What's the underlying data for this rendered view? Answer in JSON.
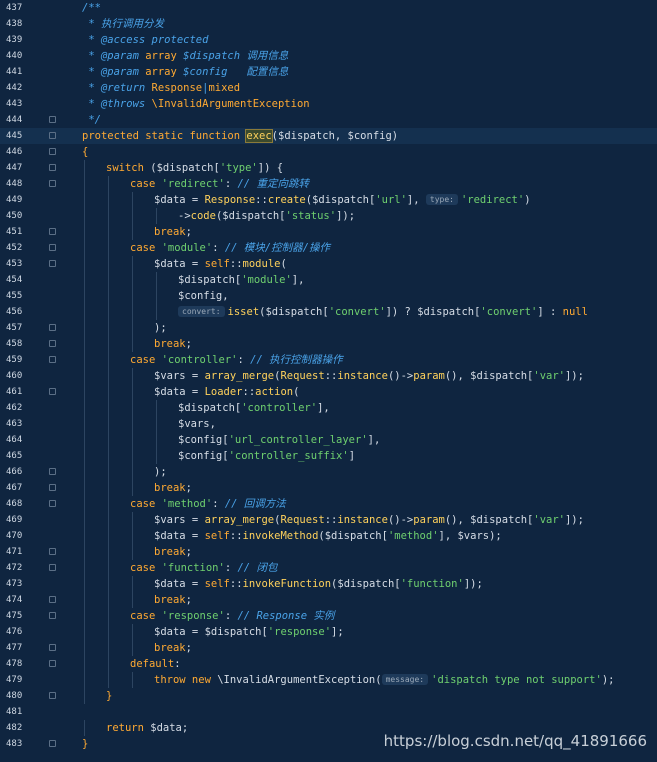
{
  "editor": {
    "lines": [
      {
        "n": "437",
        "indent": 0,
        "fold": false,
        "tokens": [
          {
            "t": "/**",
            "c": "cm"
          }
        ]
      },
      {
        "n": "438",
        "indent": 0,
        "fold": false,
        "tokens": [
          {
            "t": " * 执行调用分发",
            "c": "cm"
          }
        ]
      },
      {
        "n": "439",
        "indent": 0,
        "fold": false,
        "tokens": [
          {
            "t": " * @access protected",
            "c": "cm"
          }
        ]
      },
      {
        "n": "440",
        "indent": 0,
        "fold": false,
        "tokens": [
          {
            "t": " * @param ",
            "c": "cm"
          },
          {
            "t": "array",
            "c": "kw"
          },
          {
            "t": " $dispatch ",
            "c": "cm"
          },
          {
            "t": "调用信息",
            "c": "cm"
          }
        ]
      },
      {
        "n": "441",
        "indent": 0,
        "fold": false,
        "tokens": [
          {
            "t": " * @param ",
            "c": "cm"
          },
          {
            "t": "array",
            "c": "kw"
          },
          {
            "t": " $config   ",
            "c": "cm"
          },
          {
            "t": "配置信息",
            "c": "cm"
          }
        ]
      },
      {
        "n": "442",
        "indent": 0,
        "fold": false,
        "tokens": [
          {
            "t": " * @return ",
            "c": "cm"
          },
          {
            "t": "Response",
            "c": "kw"
          },
          {
            "t": "|",
            "c": "cm"
          },
          {
            "t": "mixed",
            "c": "kw"
          }
        ]
      },
      {
        "n": "443",
        "indent": 0,
        "fold": false,
        "tokens": [
          {
            "t": " * @throws ",
            "c": "cm"
          },
          {
            "t": "\\InvalidArgumentException",
            "c": "kw"
          }
        ]
      },
      {
        "n": "444",
        "indent": 0,
        "fold": true,
        "tokens": [
          {
            "t": " */",
            "c": "cm"
          }
        ]
      },
      {
        "n": "445",
        "indent": 0,
        "fold": true,
        "current": true,
        "tokens": [
          {
            "t": "protected static function ",
            "c": "kw"
          },
          {
            "t": "exec",
            "c": "fn",
            "hl": true
          },
          {
            "t": "($dispatch, $config)",
            "c": "var"
          }
        ]
      },
      {
        "n": "446",
        "indent": 0,
        "fold": true,
        "tokens": [
          {
            "t": "{",
            "c": "kw"
          }
        ]
      },
      {
        "n": "447",
        "indent": 1,
        "fold": true,
        "tokens": [
          {
            "t": "switch ",
            "c": "kw"
          },
          {
            "t": "($dispatch[",
            "c": "var"
          },
          {
            "t": "'type'",
            "c": "str"
          },
          {
            "t": "]) {",
            "c": "var"
          }
        ]
      },
      {
        "n": "448",
        "indent": 2,
        "fold": true,
        "tokens": [
          {
            "t": "case ",
            "c": "kw"
          },
          {
            "t": "'redirect'",
            "c": "str"
          },
          {
            "t": ": ",
            "c": "var"
          },
          {
            "t": "// 重定向跳转",
            "c": "cm"
          }
        ]
      },
      {
        "n": "449",
        "indent": 3,
        "fold": false,
        "tokens": [
          {
            "t": "$data = ",
            "c": "var"
          },
          {
            "t": "Response",
            "c": "cls"
          },
          {
            "t": "::",
            "c": "var"
          },
          {
            "t": "create",
            "c": "fn"
          },
          {
            "t": "($dispatch[",
            "c": "var"
          },
          {
            "t": "'url'",
            "c": "str"
          },
          {
            "t": "], ",
            "c": "var"
          },
          {
            "hint": "type:"
          },
          {
            "t": "'redirect'",
            "c": "str"
          },
          {
            "t": ")",
            "c": "var"
          }
        ]
      },
      {
        "n": "450",
        "indent": 4,
        "fold": false,
        "tokens": [
          {
            "t": "->",
            "c": "var"
          },
          {
            "t": "code",
            "c": "fn"
          },
          {
            "t": "($dispatch[",
            "c": "var"
          },
          {
            "t": "'status'",
            "c": "str"
          },
          {
            "t": "]);",
            "c": "var"
          }
        ]
      },
      {
        "n": "451",
        "indent": 3,
        "fold": true,
        "tokens": [
          {
            "t": "break",
            "c": "kw"
          },
          {
            "t": ";",
            "c": "var"
          }
        ]
      },
      {
        "n": "452",
        "indent": 2,
        "fold": true,
        "tokens": [
          {
            "t": "case ",
            "c": "kw"
          },
          {
            "t": "'module'",
            "c": "str"
          },
          {
            "t": ": ",
            "c": "var"
          },
          {
            "t": "// 模块/控制器/操作",
            "c": "cm"
          }
        ]
      },
      {
        "n": "453",
        "indent": 3,
        "fold": true,
        "tokens": [
          {
            "t": "$data = ",
            "c": "var"
          },
          {
            "t": "self",
            "c": "kw"
          },
          {
            "t": "::",
            "c": "var"
          },
          {
            "t": "module",
            "c": "fn"
          },
          {
            "t": "(",
            "c": "var"
          }
        ]
      },
      {
        "n": "454",
        "indent": 4,
        "fold": false,
        "tokens": [
          {
            "t": "$dispatch[",
            "c": "var"
          },
          {
            "t": "'module'",
            "c": "str"
          },
          {
            "t": "],",
            "c": "var"
          }
        ]
      },
      {
        "n": "455",
        "indent": 4,
        "fold": false,
        "tokens": [
          {
            "t": "$config,",
            "c": "var"
          }
        ]
      },
      {
        "n": "456",
        "indent": 4,
        "fold": false,
        "tokens": [
          {
            "hint": "convert:"
          },
          {
            "t": "isset",
            "c": "fn"
          },
          {
            "t": "($dispatch[",
            "c": "var"
          },
          {
            "t": "'convert'",
            "c": "str"
          },
          {
            "t": "]) ? $dispatch[",
            "c": "var"
          },
          {
            "t": "'convert'",
            "c": "str"
          },
          {
            "t": "] : ",
            "c": "var"
          },
          {
            "t": "null",
            "c": "kw"
          }
        ]
      },
      {
        "n": "457",
        "indent": 3,
        "fold": true,
        "tokens": [
          {
            "t": ");",
            "c": "var"
          }
        ]
      },
      {
        "n": "458",
        "indent": 3,
        "fold": true,
        "tokens": [
          {
            "t": "break",
            "c": "kw"
          },
          {
            "t": ";",
            "c": "var"
          }
        ]
      },
      {
        "n": "459",
        "indent": 2,
        "fold": true,
        "tokens": [
          {
            "t": "case ",
            "c": "kw"
          },
          {
            "t": "'controller'",
            "c": "str"
          },
          {
            "t": ": ",
            "c": "var"
          },
          {
            "t": "// 执行控制器操作",
            "c": "cm"
          }
        ]
      },
      {
        "n": "460",
        "indent": 3,
        "fold": false,
        "tokens": [
          {
            "t": "$vars = ",
            "c": "var"
          },
          {
            "t": "array_merge",
            "c": "fn"
          },
          {
            "t": "(",
            "c": "var"
          },
          {
            "t": "Request",
            "c": "cls"
          },
          {
            "t": "::",
            "c": "var"
          },
          {
            "t": "instance",
            "c": "fn"
          },
          {
            "t": "()->",
            "c": "var"
          },
          {
            "t": "param",
            "c": "fn"
          },
          {
            "t": "(), $dispatch[",
            "c": "var"
          },
          {
            "t": "'var'",
            "c": "str"
          },
          {
            "t": "]);",
            "c": "var"
          }
        ]
      },
      {
        "n": "461",
        "indent": 3,
        "fold": true,
        "tokens": [
          {
            "t": "$data = ",
            "c": "var"
          },
          {
            "t": "Loader",
            "c": "cls"
          },
          {
            "t": "::",
            "c": "var"
          },
          {
            "t": "action",
            "c": "fn"
          },
          {
            "t": "(",
            "c": "var"
          }
        ]
      },
      {
        "n": "462",
        "indent": 4,
        "fold": false,
        "tokens": [
          {
            "t": "$dispatch[",
            "c": "var"
          },
          {
            "t": "'controller'",
            "c": "str"
          },
          {
            "t": "],",
            "c": "var"
          }
        ]
      },
      {
        "n": "463",
        "indent": 4,
        "fold": false,
        "tokens": [
          {
            "t": "$vars,",
            "c": "var"
          }
        ]
      },
      {
        "n": "464",
        "indent": 4,
        "fold": false,
        "tokens": [
          {
            "t": "$config[",
            "c": "var"
          },
          {
            "t": "'url_controller_layer'",
            "c": "str"
          },
          {
            "t": "],",
            "c": "var"
          }
        ]
      },
      {
        "n": "465",
        "indent": 4,
        "fold": false,
        "tokens": [
          {
            "t": "$config[",
            "c": "var"
          },
          {
            "t": "'controller_suffix'",
            "c": "str"
          },
          {
            "t": "]",
            "c": "var"
          }
        ]
      },
      {
        "n": "466",
        "indent": 3,
        "fold": true,
        "tokens": [
          {
            "t": ");",
            "c": "var"
          }
        ]
      },
      {
        "n": "467",
        "indent": 3,
        "fold": true,
        "tokens": [
          {
            "t": "break",
            "c": "kw"
          },
          {
            "t": ";",
            "c": "var"
          }
        ]
      },
      {
        "n": "468",
        "indent": 2,
        "fold": true,
        "tokens": [
          {
            "t": "case ",
            "c": "kw"
          },
          {
            "t": "'method'",
            "c": "str"
          },
          {
            "t": ": ",
            "c": "var"
          },
          {
            "t": "// 回调方法",
            "c": "cm"
          }
        ]
      },
      {
        "n": "469",
        "indent": 3,
        "fold": false,
        "tokens": [
          {
            "t": "$vars = ",
            "c": "var"
          },
          {
            "t": "array_merge",
            "c": "fn"
          },
          {
            "t": "(",
            "c": "var"
          },
          {
            "t": "Request",
            "c": "cls"
          },
          {
            "t": "::",
            "c": "var"
          },
          {
            "t": "instance",
            "c": "fn"
          },
          {
            "t": "()->",
            "c": "var"
          },
          {
            "t": "param",
            "c": "fn"
          },
          {
            "t": "(), $dispatch[",
            "c": "var"
          },
          {
            "t": "'var'",
            "c": "str"
          },
          {
            "t": "]);",
            "c": "var"
          }
        ]
      },
      {
        "n": "470",
        "indent": 3,
        "fold": false,
        "tokens": [
          {
            "t": "$data = ",
            "c": "var"
          },
          {
            "t": "self",
            "c": "kw"
          },
          {
            "t": "::",
            "c": "var"
          },
          {
            "t": "invokeMethod",
            "c": "fn"
          },
          {
            "t": "($dispatch[",
            "c": "var"
          },
          {
            "t": "'method'",
            "c": "str"
          },
          {
            "t": "], $vars);",
            "c": "var"
          }
        ]
      },
      {
        "n": "471",
        "indent": 3,
        "fold": true,
        "tokens": [
          {
            "t": "break",
            "c": "kw"
          },
          {
            "t": ";",
            "c": "var"
          }
        ]
      },
      {
        "n": "472",
        "indent": 2,
        "fold": true,
        "tokens": [
          {
            "t": "case ",
            "c": "kw"
          },
          {
            "t": "'function'",
            "c": "str"
          },
          {
            "t": ": ",
            "c": "var"
          },
          {
            "t": "// 闭包",
            "c": "cm"
          }
        ]
      },
      {
        "n": "473",
        "indent": 3,
        "fold": false,
        "tokens": [
          {
            "t": "$data = ",
            "c": "var"
          },
          {
            "t": "self",
            "c": "kw"
          },
          {
            "t": "::",
            "c": "var"
          },
          {
            "t": "invokeFunction",
            "c": "fn"
          },
          {
            "t": "($dispatch[",
            "c": "var"
          },
          {
            "t": "'function'",
            "c": "str"
          },
          {
            "t": "]);",
            "c": "var"
          }
        ]
      },
      {
        "n": "474",
        "indent": 3,
        "fold": true,
        "tokens": [
          {
            "t": "break",
            "c": "kw"
          },
          {
            "t": ";",
            "c": "var"
          }
        ]
      },
      {
        "n": "475",
        "indent": 2,
        "fold": true,
        "tokens": [
          {
            "t": "case ",
            "c": "kw"
          },
          {
            "t": "'response'",
            "c": "str"
          },
          {
            "t": ": ",
            "c": "var"
          },
          {
            "t": "// Response 实例",
            "c": "cm"
          }
        ]
      },
      {
        "n": "476",
        "indent": 3,
        "fold": false,
        "tokens": [
          {
            "t": "$data = $dispatch[",
            "c": "var"
          },
          {
            "t": "'response'",
            "c": "str"
          },
          {
            "t": "];",
            "c": "var"
          }
        ]
      },
      {
        "n": "477",
        "indent": 3,
        "fold": true,
        "tokens": [
          {
            "t": "break",
            "c": "kw"
          },
          {
            "t": ";",
            "c": "var"
          }
        ]
      },
      {
        "n": "478",
        "indent": 2,
        "fold": true,
        "tokens": [
          {
            "t": "default",
            "c": "kw"
          },
          {
            "t": ":",
            "c": "var"
          }
        ]
      },
      {
        "n": "479",
        "indent": 3,
        "fold": false,
        "tokens": [
          {
            "t": "throw new ",
            "c": "kw"
          },
          {
            "t": "\\InvalidArgumentException",
            "c": "var"
          },
          {
            "t": "(",
            "c": "var"
          },
          {
            "hint": "message:"
          },
          {
            "t": "'dispatch type not support'",
            "c": "str"
          },
          {
            "t": ");",
            "c": "var"
          }
        ]
      },
      {
        "n": "480",
        "indent": 1,
        "fold": true,
        "tokens": [
          {
            "t": "}",
            "c": "kw"
          }
        ]
      },
      {
        "n": "481",
        "indent": 0,
        "fold": false,
        "tokens": []
      },
      {
        "n": "482",
        "indent": 1,
        "fold": false,
        "tokens": [
          {
            "t": "return ",
            "c": "kw"
          },
          {
            "t": "$data;",
            "c": "var"
          }
        ]
      },
      {
        "n": "483",
        "indent": 0,
        "fold": true,
        "tokens": [
          {
            "t": "}",
            "c": "kw"
          }
        ]
      }
    ]
  },
  "watermark": "https://blog.csdn.net/qq_41891666"
}
